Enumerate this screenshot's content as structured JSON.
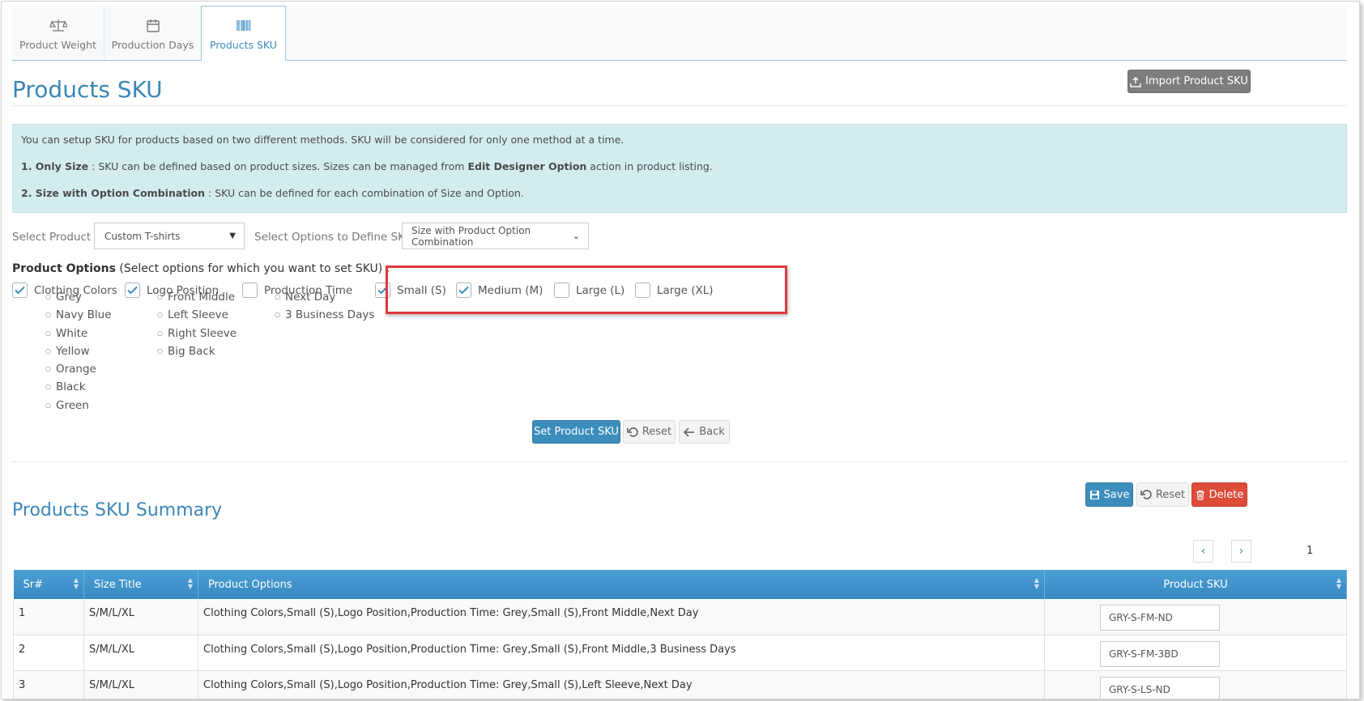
{
  "tabs": [
    {
      "label": "Product Weight",
      "icon": "scale-icon"
    },
    {
      "label": "Production Days",
      "icon": "calendar-icon"
    },
    {
      "label": "Products SKU",
      "icon": "barcode-icon"
    }
  ],
  "page_title": "Products SKU",
  "import_button": "Import Product SKU",
  "info": {
    "line1": "You can setup SKU for products based on two different methods. SKU will be considered for only one method at a time.",
    "line2_bold": "1. Only Size",
    "line2_a": " : SKU can be defined based on product sizes. Sizes can be managed from ",
    "line2_bold2": "Edit Designer Option",
    "line2_b": " action in product listing.",
    "line3_bold": "2. Size with Option Combination",
    "line3": " : SKU can be defined for each combination of Size and Option."
  },
  "select_product": {
    "label": "Select Product",
    "value": "Custom T-shirts"
  },
  "select_options": {
    "label": "Select Options to Define SKU",
    "value": "Size with Product Option Combination"
  },
  "product_options": {
    "heading_bold": "Product Options",
    "heading_rest": " (Select options for which you want to set SKU) :",
    "groups": [
      {
        "label": "Clothing Colors",
        "checked": true,
        "items": [
          "Grey",
          "Navy Blue",
          "White",
          "Yellow",
          "Orange",
          "Black",
          "Green"
        ]
      },
      {
        "label": "Logo Position",
        "checked": true,
        "items": [
          "Front Middle",
          "Left Sleeve",
          "Right Sleeve",
          "Big Back"
        ]
      },
      {
        "label": "Production Time",
        "checked": false,
        "items": [
          "Next Day",
          "3 Business Days"
        ]
      }
    ],
    "sizes": [
      {
        "label": "Small (S)",
        "checked": true
      },
      {
        "label": "Medium (M)",
        "checked": true
      },
      {
        "label": "Large (L)",
        "checked": false
      },
      {
        "label": "Large (XL)",
        "checked": false
      }
    ]
  },
  "actions": {
    "set": "Set Product SKU",
    "reset": "Reset",
    "back": "Back"
  },
  "summary": {
    "title": "Products SKU Summary",
    "save": "Save",
    "reset": "Reset",
    "delete": "Delete",
    "page": "1",
    "columns": [
      "Sr#",
      "Size Title",
      "Product Options",
      "Product SKU"
    ],
    "rows": [
      {
        "sr": "1",
        "size": "S/M/L/XL",
        "options": "Clothing Colors,Small (S),Logo Position,Production Time: Grey,Small (S),Front Middle,Next Day",
        "sku": "GRY-S-FM-ND"
      },
      {
        "sr": "2",
        "size": "S/M/L/XL",
        "options": "Clothing Colors,Small (S),Logo Position,Production Time: Grey,Small (S),Front Middle,3 Business Days",
        "sku": "GRY-S-FM-3BD"
      },
      {
        "sr": "3",
        "size": "S/M/L/XL",
        "options": "Clothing Colors,Small (S),Logo Position,Production Time: Grey,Small (S),Left Sleeve,Next Day",
        "sku": "GRY-S-LS-ND"
      }
    ]
  },
  "colors": {
    "accent": "#3c8dbc",
    "highlight": "#e0393e",
    "danger": "#dd4b39"
  }
}
